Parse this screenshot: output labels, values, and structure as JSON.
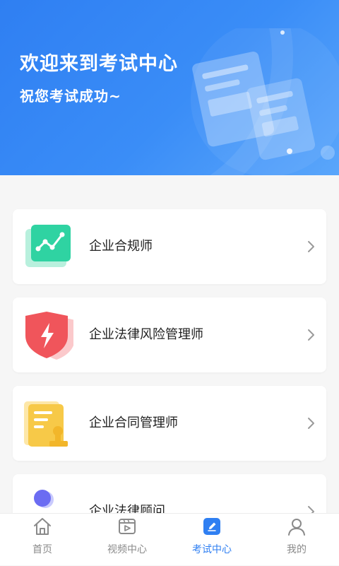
{
  "banner": {
    "title": "欢迎来到考试中心",
    "subtitle": "祝您考试成功~"
  },
  "exams": [
    {
      "label": "企业合规师",
      "icon": "chart-line-icon"
    },
    {
      "label": "企业法律风险管理师",
      "icon": "shield-lightning-icon"
    },
    {
      "label": "企业合同管理师",
      "icon": "document-seal-icon"
    },
    {
      "label": "企业法律顾问",
      "icon": "person-icon"
    }
  ],
  "tabbar": {
    "items": [
      {
        "label": "首页",
        "icon": "home-icon",
        "active": false
      },
      {
        "label": "视频中心",
        "icon": "video-icon",
        "active": false
      },
      {
        "label": "考试中心",
        "icon": "edit-icon",
        "active": true
      },
      {
        "label": "我的",
        "icon": "user-icon",
        "active": false
      }
    ]
  },
  "colors": {
    "accent": "#2f7ff2",
    "inactive": "#8a8a8a",
    "green": "#2fd3a2",
    "red": "#f0555b",
    "yellow": "#f7c948",
    "purple": "#6b6cf2"
  }
}
